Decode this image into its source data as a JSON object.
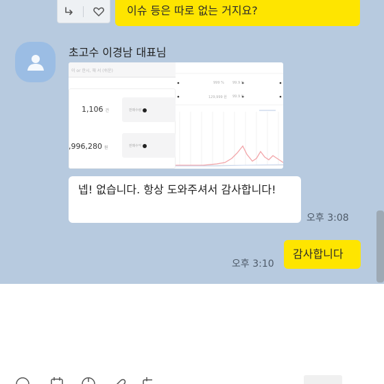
{
  "chat": {
    "top_message": "이슈 등은 따로 없는 거지요?",
    "sender_name": "초고수 이경남 대표님",
    "image": {
      "header_text": "이 or 한시, 해 서 (쉬운)",
      "stats": [
        {
          "value": "1,106",
          "unit": "건",
          "label": "판매수량"
        },
        {
          "value": ",996,280",
          "unit": "원",
          "label": "판매수익"
        }
      ],
      "right_labels": [
        "999 %",
        "99.9 %",
        "129,999 원",
        "99.9 %"
      ]
    },
    "reply_message": "넵! 없습니다. 항상 도와주셔서 감사합니다!",
    "reply_time": "오후 3:08",
    "my_message": "감사합니다",
    "my_time": "오후 3:10"
  },
  "colors": {
    "chat_bg": "#b7cadf",
    "my_bubble": "#fee500",
    "other_bubble": "#ffffff",
    "avatar_bg": "#9bbde4"
  },
  "icons": {
    "reply": "reply-arrow-icon",
    "like": "heart-icon",
    "avatar": "default-profile-icon",
    "toolbar": [
      "emoji-icon",
      "calendar-icon",
      "capture-icon",
      "attach-icon",
      "schedule-icon"
    ]
  }
}
